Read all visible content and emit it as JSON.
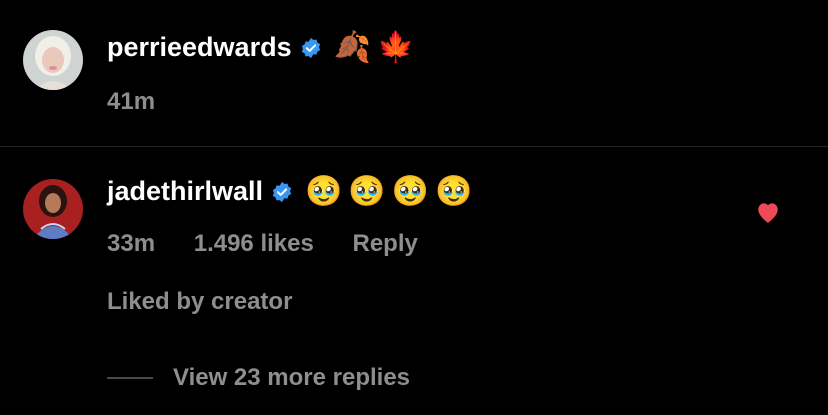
{
  "comments": [
    {
      "username": "perrieedwards",
      "verified": true,
      "text_emojis": [
        "🍂",
        "🍁"
      ],
      "time": "41m",
      "avatar_icon": "avatar-blonde-woman"
    },
    {
      "username": "jadethirlwall",
      "verified": true,
      "text_emojis": [
        "🥹",
        "🥹",
        "🥹",
        "🥹"
      ],
      "time": "33m",
      "likes": "1.496 likes",
      "reply_label": "Reply",
      "liked": true,
      "liked_by": "Liked by creator",
      "view_more": "View 23 more replies",
      "avatar_icon": "avatar-dark-hair-woman"
    }
  ],
  "colors": {
    "background": "#000000",
    "secondary_text": "#8e8e8e",
    "verified_blue": "#3897f0",
    "heart_red": "#ed4956"
  }
}
